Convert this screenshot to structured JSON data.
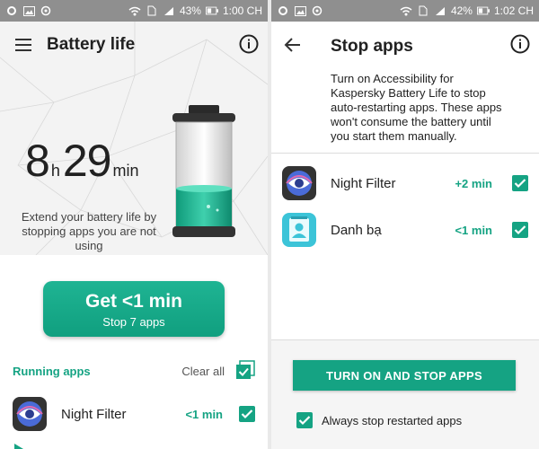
{
  "colors": {
    "accent": "#15a383",
    "statusbar": "#8f8f8f"
  },
  "left": {
    "status": {
      "battery": "43%",
      "time": "1:00 CH"
    },
    "title": "Battery life",
    "time": {
      "hours": "8",
      "hours_unit": "h",
      "minutes": "29",
      "minutes_unit": "min"
    },
    "hint": "Extend your battery life by stopping apps you are not using",
    "cta": {
      "primary": "Get <1 min",
      "secondary": "Stop 7 apps"
    },
    "running_label": "Running apps",
    "clear_all": "Clear all",
    "apps": [
      {
        "name": "Night Filter",
        "gain": "<1 min",
        "icon": "eye-icon"
      }
    ]
  },
  "right": {
    "status": {
      "battery": "42%",
      "time": "1:02 CH"
    },
    "title": "Stop apps",
    "description": "Turn on Accessibility for Kaspersky Battery Life to stop auto-restarting apps. These apps won't consume the battery until you start them manually.",
    "apps": [
      {
        "name": "Night Filter",
        "gain": "+2 min",
        "icon": "eye-icon"
      },
      {
        "name": "Danh bạ",
        "gain": "<1 min",
        "icon": "contacts-icon"
      }
    ],
    "button": "TURN ON AND STOP APPS",
    "always_stop": "Always stop restarted apps"
  }
}
